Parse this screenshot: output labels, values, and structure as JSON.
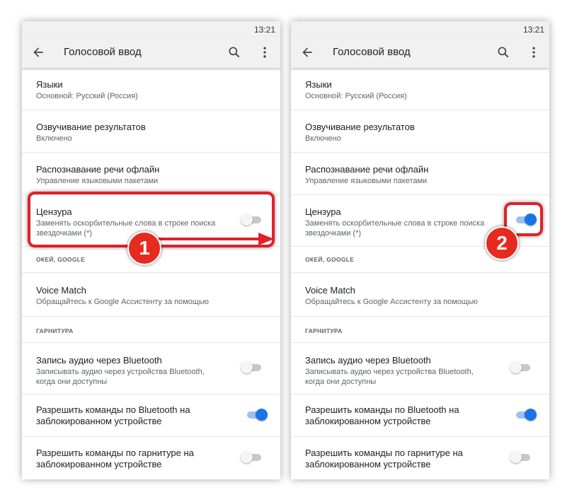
{
  "screens": [
    {
      "status_time": "13:21",
      "toolbar_title": "Голосовой ввод",
      "censorship_toggle": "off",
      "step_number": "1"
    },
    {
      "status_time": "13:21",
      "toolbar_title": "Голосовой ввод",
      "censorship_toggle": "on",
      "step_number": "2"
    }
  ],
  "settings": {
    "languages": {
      "title": "Языки",
      "subtitle": "Основной: Русский (Россия)"
    },
    "speech_output": {
      "title": "Озвучивание результатов",
      "subtitle": "Включено"
    },
    "offline": {
      "title": "Распознавание речи офлайн",
      "subtitle": "Управление языковыми пакетами"
    },
    "censorship": {
      "title": "Цензура",
      "subtitle_1": "Заменять оскорбительные слова в строке поиска",
      "subtitle_2": "звездочками (*)"
    },
    "section_ok_google": "ОКЕЙ, GOOGLE",
    "voice_match": {
      "title": "Voice Match",
      "subtitle": "Обращайтесь к Google Ассистенту за помощью"
    },
    "section_headset": "ГАРНИТУРА",
    "bt_audio": {
      "title": "Запись аудио через Bluetooth",
      "subtitle_1": "Записывать аудио через устройства Bluetooth,",
      "subtitle_2": "когда они доступны",
      "toggle": "off"
    },
    "bt_locked": {
      "title_1": "Разрешить команды по Bluetooth на",
      "title_2": "заблокированном устройстве",
      "toggle": "on"
    },
    "headset_locked": {
      "title_1": "Разрешить команды по гарнитуре на",
      "title_2": "заблокированном устройстве",
      "toggle": "off"
    }
  },
  "colors": {
    "accent": "#1a73e8",
    "highlight": "#e0202a",
    "badge": "#e62a1f"
  },
  "icons": [
    "back-arrow-icon",
    "search-icon",
    "more-vert-icon"
  ]
}
